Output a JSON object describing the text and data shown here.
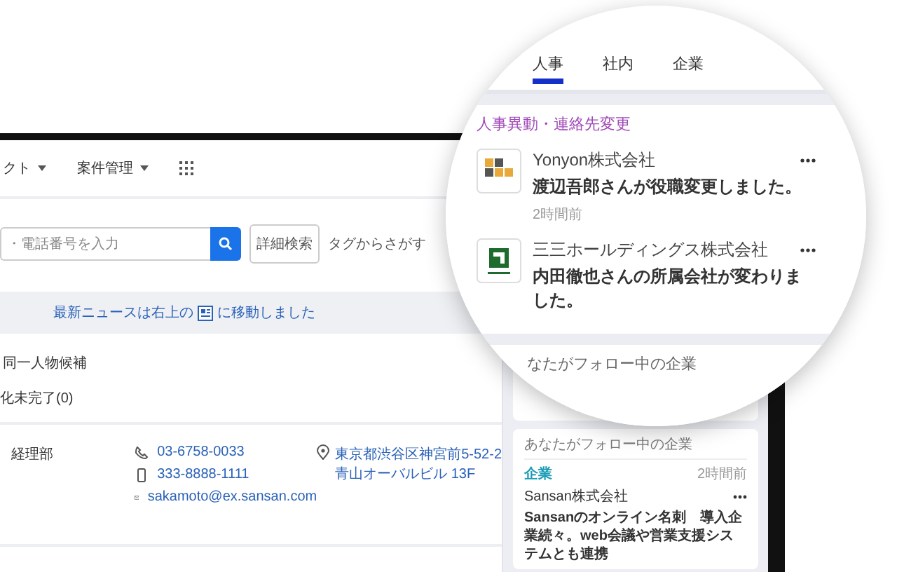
{
  "nav": {
    "items": [
      {
        "label": "クト"
      },
      {
        "label": "案件管理"
      }
    ]
  },
  "search": {
    "placeholder": "・電話番号を入力",
    "detail_button": "詳細検索",
    "tag_search": "タグからさがす"
  },
  "notice": {
    "before": "最新ニュースは右上の",
    "after": "に移動しました"
  },
  "candidates_label": "同一人物候補",
  "incomplete": "化未完了(0)",
  "contacts": [
    {
      "department": "経理部",
      "phone": "03-6758-0033",
      "mobile": "333-8888-1111",
      "email": "sakamoto@ex.sansan.com",
      "address": [
        "東京都渋谷区神宮前5-52-2",
        "青山オーバルビル 13F"
      ]
    }
  ],
  "follow_card": {
    "heading": "あなたがフォロー中の企業",
    "tag": "企業",
    "time": "2時間前",
    "company": "Sansan株式会社",
    "headline": "Sansanのオンライン名刺　導入企業続々。web会議や営業支援システムとも連携"
  },
  "magnifier": {
    "tabs": [
      {
        "label": "人事",
        "selected": true
      },
      {
        "label": "社内",
        "selected": false
      },
      {
        "label": "企業",
        "selected": false
      }
    ],
    "section": "人事異動・連絡先変更",
    "items": [
      {
        "kind": "squares",
        "company": "Yonyon株式会社",
        "message": "渡辺吾郎さんが役職変更しました。",
        "time": "2時間前"
      },
      {
        "kind": "green",
        "company": "三三ホールディングス株式会社",
        "message": "内田徹也さんの所属会社が変わりました。"
      }
    ],
    "following_label": "なたがフォロー中の企業"
  }
}
